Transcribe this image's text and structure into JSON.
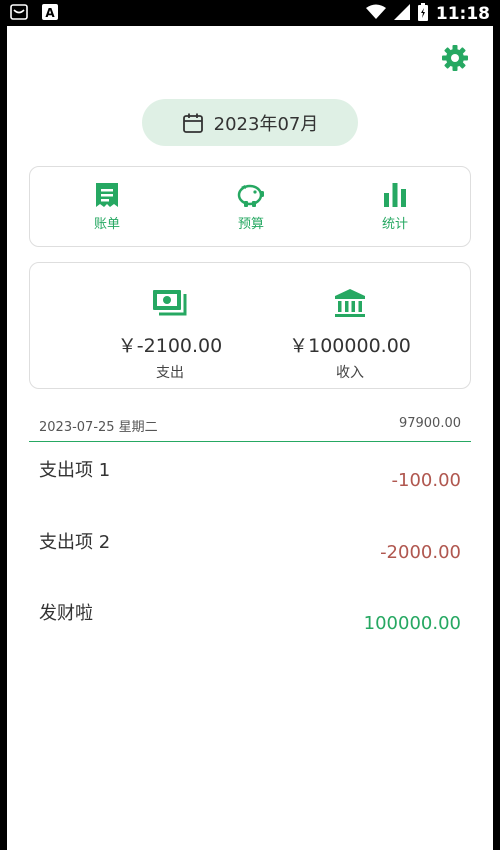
{
  "status_bar": {
    "time": "11:18",
    "left_icons": [
      "notification-icon",
      "app-a-icon"
    ],
    "right_icons": [
      "wifi-icon",
      "signal-icon",
      "battery-icon"
    ]
  },
  "header": {
    "settings_icon": "gear-icon",
    "month_selector": {
      "icon": "calendar-icon",
      "label": "2023年07月"
    }
  },
  "nav": {
    "items": [
      {
        "icon": "receipt-icon",
        "label": "账单"
      },
      {
        "icon": "piggy-bank-icon",
        "label": "预算"
      },
      {
        "icon": "bar-chart-icon",
        "label": "统计"
      }
    ]
  },
  "summary": {
    "expense": {
      "icon": "cash-icon",
      "amount": "￥-2100.00",
      "label": "支出"
    },
    "income": {
      "icon": "bank-icon",
      "amount": "￥100000.00",
      "label": "收入"
    }
  },
  "day_group": {
    "date": "2023-07-25 星期二",
    "total": "97900.00"
  },
  "transactions": [
    {
      "name": "支出项 1",
      "amount": "-100.00",
      "type": "expense"
    },
    {
      "name": "支出项 2",
      "amount": "-2000.00",
      "type": "expense"
    },
    {
      "name": "发财啦",
      "amount": "100000.00",
      "type": "income"
    }
  ],
  "colors": {
    "accent": "#26a862",
    "pill_bg": "#dff0e5",
    "expense": "#b0574f",
    "income": "#26a862"
  }
}
